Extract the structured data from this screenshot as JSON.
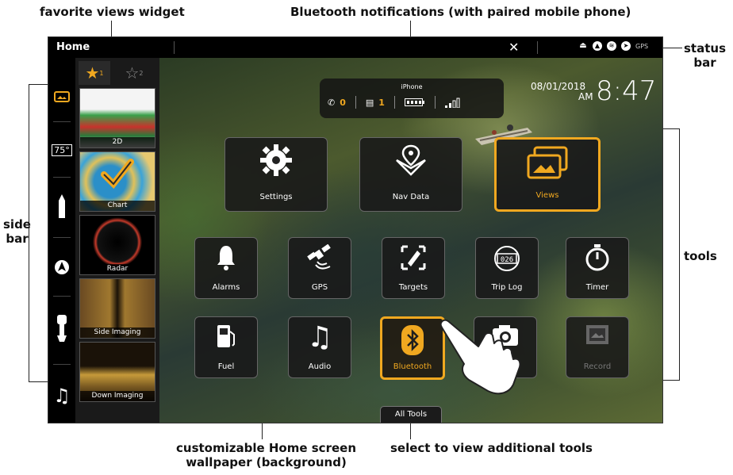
{
  "callouts": {
    "favorite_views": "favorite views widget",
    "bluetooth_notifications": "Bluetooth notifications (with paired mobile phone)",
    "status_bar_line1": "status",
    "status_bar_line2": "bar",
    "side_bar_line1": "side",
    "side_bar_line2": "bar",
    "tools": "tools",
    "wallpaper_line1": "customizable Home screen",
    "wallpaper_line2": "wallpaper (background)",
    "all_tools_hint": "select to view additional tools"
  },
  "statusbar": {
    "title": "Home",
    "close_symbol": "✕",
    "gps_text": "GPS"
  },
  "sidebar": {
    "items": [
      {
        "icon": "views-icon"
      },
      {
        "icon": "temperature-icon",
        "label": "75°"
      },
      {
        "icon": "boat-icon"
      },
      {
        "icon": "compass-icon"
      },
      {
        "icon": "motor-icon"
      },
      {
        "icon": "music-icon"
      }
    ]
  },
  "favorites": {
    "tab1_label": "★",
    "tab1_sub": "1",
    "tab2_label": "☆",
    "tab2_sub": "2",
    "views": [
      {
        "label": "2D"
      },
      {
        "label": "Chart"
      },
      {
        "label": "Radar"
      },
      {
        "label": "Side Imaging"
      },
      {
        "label": "Down Imaging"
      }
    ]
  },
  "notifications": {
    "device": "iPhone",
    "missed_calls": "0",
    "messages": "1"
  },
  "clock": {
    "date": "08/01/2018",
    "ampm": "AM",
    "time": "8:47"
  },
  "tools": {
    "settings": "Settings",
    "nav_data": "Nav Data",
    "views": "Views",
    "alarms": "Alarms",
    "gps": "GPS",
    "targets": "Targets",
    "trip_log": "Trip Log",
    "timer": "Timer",
    "fuel": "Fuel",
    "audio": "Audio",
    "bluetooth": "Bluetooth",
    "record": "Record",
    "all_tools": "All Tools"
  },
  "colors": {
    "accent": "#f0a820"
  }
}
